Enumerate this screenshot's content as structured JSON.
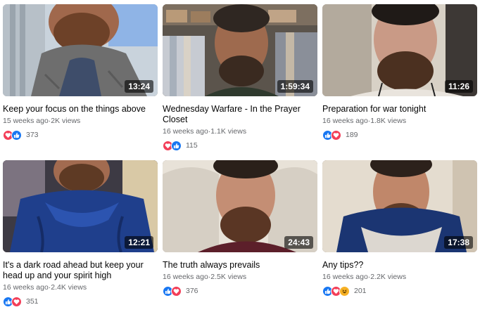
{
  "colors": {
    "like": "#1877f2",
    "love": "#f33e58",
    "haha": "#f7b125",
    "meta_text": "#65676b"
  },
  "videos": [
    {
      "title": "Keep your focus on the things above",
      "meta": "15 weeks ago·2K views",
      "duration": "13:24",
      "reaction_icons": [
        "love-icon",
        "like-icon"
      ],
      "reaction_count": "373"
    },
    {
      "title": "Wednesday Warfare - In the Prayer Closet",
      "meta": "16 weeks ago·1.1K views",
      "duration": "1:59:34",
      "reaction_icons": [
        "love-icon",
        "like-icon"
      ],
      "reaction_count": "115"
    },
    {
      "title": "Preparation for war tonight",
      "meta": "16 weeks ago·1.8K views",
      "duration": "11:26",
      "reaction_icons": [
        "like-icon",
        "love-icon"
      ],
      "reaction_count": "189"
    },
    {
      "title": "It's a dark road ahead but keep your head up and your spirit high",
      "meta": "16 weeks ago·2.4K views",
      "duration": "12:21",
      "reaction_icons": [
        "like-icon",
        "love-icon"
      ],
      "reaction_count": "351"
    },
    {
      "title": "The truth always prevails",
      "meta": "16 weeks ago·2.5K views",
      "duration": "24:43",
      "reaction_icons": [
        "like-icon",
        "love-icon"
      ],
      "reaction_count": "376"
    },
    {
      "title": "Any tips??",
      "meta": "16 weeks ago·2.2K views",
      "duration": "17:38",
      "reaction_icons": [
        "like-icon",
        "love-icon",
        "haha-icon"
      ],
      "reaction_count": "201"
    }
  ]
}
